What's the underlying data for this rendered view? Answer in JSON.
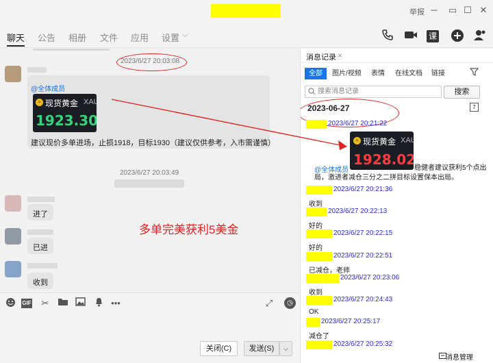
{
  "titlebar": {
    "report": "举报",
    "minimize": "─",
    "maximize": "☐",
    "close": "✕"
  },
  "nav": {
    "tabs": [
      "聊天",
      "公告",
      "相册",
      "文件",
      "应用",
      "设置"
    ],
    "settings_arrow": "⌵",
    "icons": [
      "phone-icon",
      "video-icon",
      "class-icon",
      "add-icon",
      "more-icon"
    ],
    "class_glyph": "课"
  },
  "chat": {
    "timestamp_1": "2023/6/27 20:03:08",
    "mention": "@全体成员",
    "gold_card_1": {
      "title": "现货黄金",
      "symbol": "XAU",
      "price": "1923.30"
    },
    "advice": "建议现价多单进场，止损1918，目标1930（建议仅供参考，入市需谨慎）",
    "timestamp_2": "2023/6/27 20:03:49",
    "msg_entered": "进了",
    "msg_already": "已进",
    "msg_received": "收到",
    "annotation": "多单完美获利5美金"
  },
  "toolbar": {
    "icons": [
      "emoji-icon",
      "gif-icon",
      "scissors-icon",
      "folder-icon",
      "image-icon",
      "bell-icon",
      "more-dots-icon",
      "expand-icon",
      "history-icon"
    ],
    "gif_label": "GIF"
  },
  "input": {
    "close_btn": "关闭(C)",
    "send_btn": "发送(S)"
  },
  "history": {
    "title": "消息记录",
    "tabs": [
      "全部",
      "图片/视频",
      "表情",
      "在线文档",
      "链接"
    ],
    "search_placeholder": "搜索消息记录",
    "search_btn": "搜索",
    "date": "2023-06-27",
    "gold_card_2": {
      "title": "现货黄金",
      "symbol": "XAU",
      "price": "1928.02"
    },
    "mention": "@全体成员",
    "long_msg": "稳健者建议获利5个点出局，激进者减仓三分之二拼目标设置保本出局。",
    "messages": [
      {
        "time": "2023/6/27 20:21:22",
        "text": ""
      },
      {
        "time": "2023/6/27 20:21:36",
        "text": "收到"
      },
      {
        "time": "2023/6/27 20:22:13",
        "text": "好的"
      },
      {
        "time": "2023/6/27 20:22:15",
        "text": "好的"
      },
      {
        "time": "2023/6/27 20:22:51",
        "text": "已减仓，老师"
      },
      {
        "time": "2023/6/27 20:23:06",
        "text": "收到"
      },
      {
        "time": "2023/6/27 20:24:43",
        "text": "OK"
      },
      {
        "time": "2023/6/27 20:25:17",
        "text": "减仓了"
      },
      {
        "time": "2023/6/27 20:25:32",
        "text": ""
      }
    ],
    "manage": "消息管理"
  },
  "colors": {
    "accent": "#1a73e8",
    "annotation_red": "#e02424",
    "highlight_yellow": "#ffff00",
    "price_green": "#3cd07c",
    "price_red": "#ff3b3b"
  }
}
